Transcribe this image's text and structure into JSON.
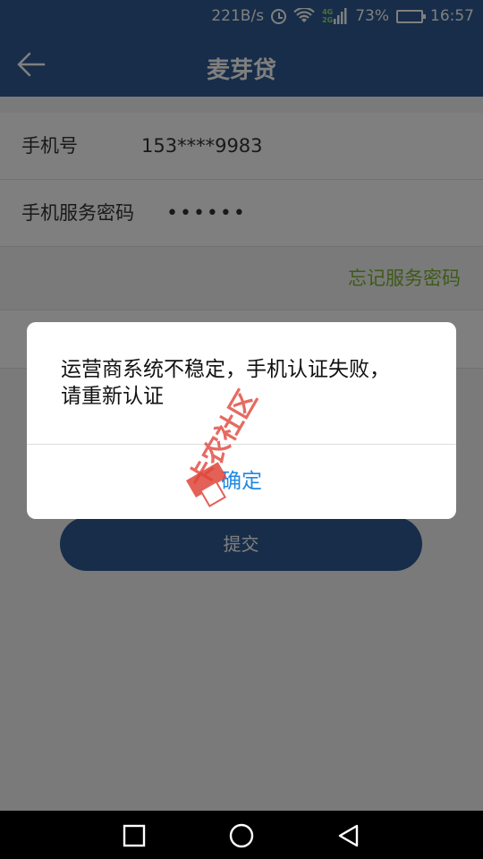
{
  "status_bar": {
    "net_speed": "221B/s",
    "network_top": "4G",
    "network_bottom": "2G",
    "battery": "73%",
    "time": "16:57",
    "icons": [
      "alarm-icon",
      "wifi-icon",
      "signal-icon",
      "battery-icon"
    ]
  },
  "app_bar": {
    "title": "麦芽贷",
    "back_icon": "arrow-left-icon"
  },
  "form": {
    "phone_label": "手机号",
    "phone_value": "153****9983",
    "password_label": "手机服务密码",
    "password_value": "••••••",
    "forgot_link": "忘记服务密码",
    "submit_label": "提交"
  },
  "dialog": {
    "message_line1": "运营商系统不稳定，手机认证失败，",
    "message_line2": "请重新认证",
    "confirm_label": "确定"
  },
  "watermark": {
    "text": "卡农社区"
  },
  "nav_bar": {
    "icons": [
      "square-icon",
      "circle-icon",
      "triangle-back-icon"
    ]
  },
  "colors": {
    "primary": "#2f5a92",
    "link_green": "#7cb431",
    "dialog_button_blue": "#1e88e5",
    "watermark_red": "#e0463a"
  }
}
